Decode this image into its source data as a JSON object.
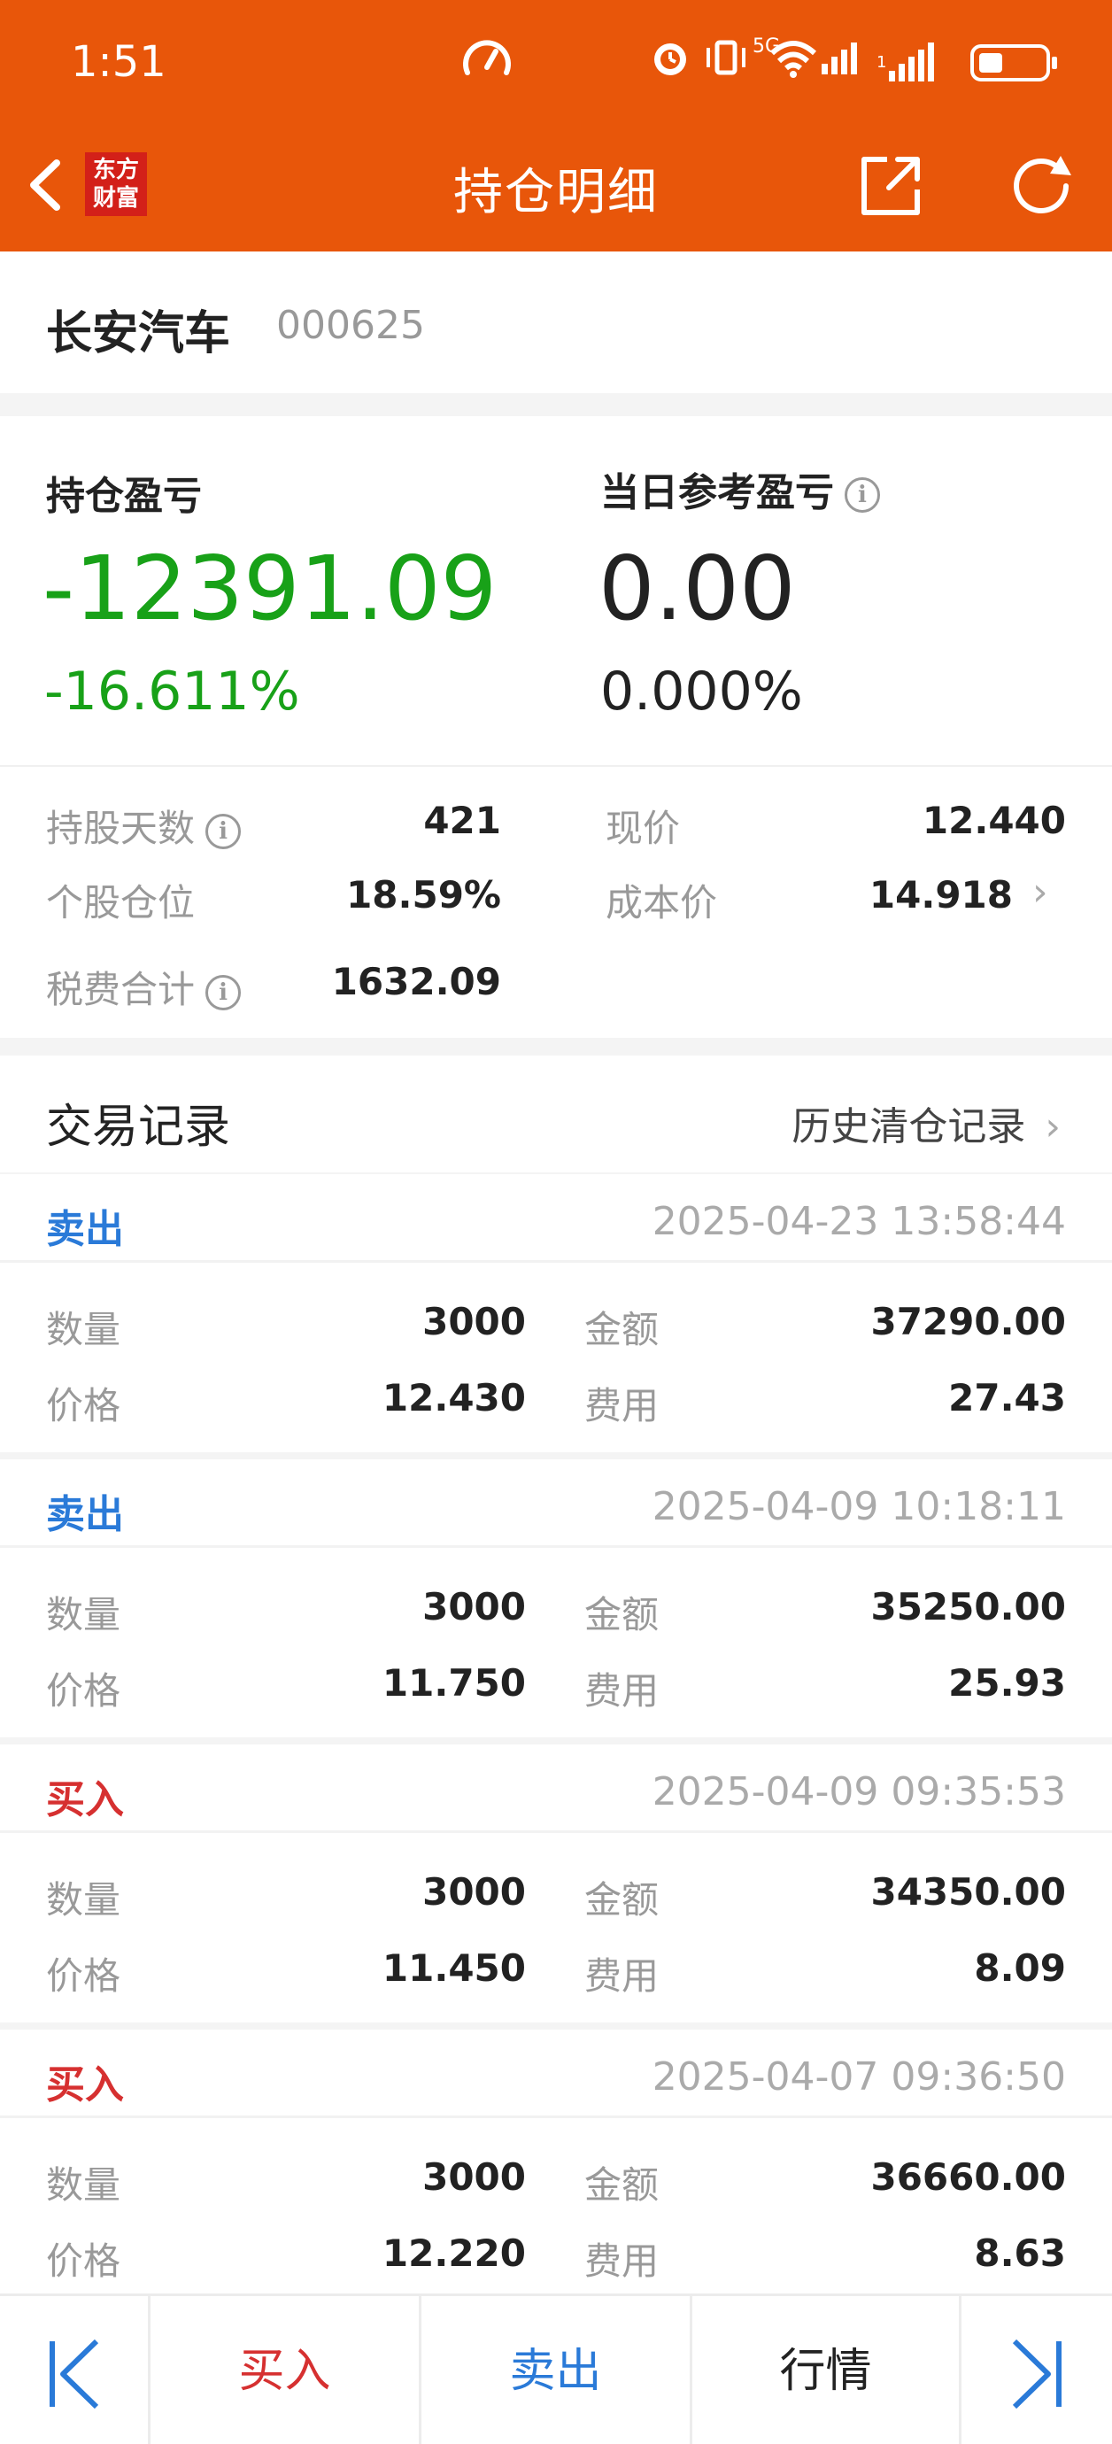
{
  "status_bar": {
    "time": "1:51",
    "network": "5G",
    "sim2": "1"
  },
  "nav": {
    "title": "持仓明细",
    "logo_line1": "东方",
    "logo_line2": "财富"
  },
  "stock": {
    "name": "长安汽车",
    "code": "000625"
  },
  "pl": {
    "holding_label": "持仓盈亏",
    "holding_value": "-12391.09",
    "holding_pct": "-16.611%",
    "daily_label": "当日参考盈亏",
    "daily_value": "0.00",
    "daily_pct": "0.000%"
  },
  "stats": {
    "days_label": "持股天数",
    "days_value": "421",
    "price_label": "现价",
    "price_value": "12.440",
    "position_label": "个股仓位",
    "position_value": "18.59%",
    "cost_label": "成本价",
    "cost_value": "14.918",
    "fee_label": "税费合计",
    "fee_value": "1632.09"
  },
  "trades_header": {
    "title": "交易记录",
    "history_link": "历史清仓记录"
  },
  "labels": {
    "qty": "数量",
    "amount": "金额",
    "price": "价格",
    "fee": "费用"
  },
  "trades": [
    {
      "type": "卖出",
      "time": "2025-04-23 13:58:44",
      "qty": "3000",
      "amount": "37290.00",
      "price": "12.430",
      "fee": "27.43"
    },
    {
      "type": "卖出",
      "time": "2025-04-09 10:18:11",
      "qty": "3000",
      "amount": "35250.00",
      "price": "11.750",
      "fee": "25.93"
    },
    {
      "type": "买入",
      "time": "2025-04-09 09:35:53",
      "qty": "3000",
      "amount": "34350.00",
      "price": "11.450",
      "fee": "8.09"
    },
    {
      "type": "买入",
      "time": "2025-04-07 09:36:50",
      "qty": "3000",
      "amount": "36660.00",
      "price": "12.220",
      "fee": "8.63"
    }
  ],
  "bottom_bar": {
    "buy": "买入",
    "sell": "卖出",
    "quote": "行情"
  },
  "colors": {
    "header": "#e8560a",
    "loss": "#18a118",
    "sell": "#2a7ad8",
    "buy": "#d63030"
  }
}
